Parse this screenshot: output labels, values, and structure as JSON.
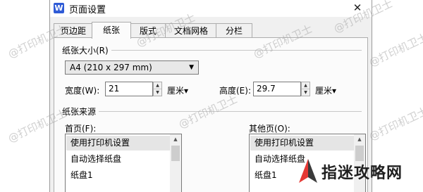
{
  "dialog": {
    "app_icon_letter": "W",
    "title": "页面设置",
    "close_glyph": "✕"
  },
  "tabs": [
    {
      "label": "页边距"
    },
    {
      "label": "纸张"
    },
    {
      "label": "版式"
    },
    {
      "label": "文档网格"
    },
    {
      "label": "分栏"
    }
  ],
  "paper_size": {
    "group_label": "纸张大小(R)",
    "selected": "A4 (210 x 297 mm)",
    "width_label": "宽度(W):",
    "width_value": "21",
    "width_unit": "厘米▾",
    "height_label": "高度(E):",
    "height_value": "29.7",
    "height_unit": "厘米▾"
  },
  "paper_source": {
    "group_label": "纸张来源",
    "first_page_label": "首页(F):",
    "first_page_items": [
      "使用打印机设置",
      "自动选择纸盘",
      "纸盘1"
    ],
    "other_pages_label": "其他页(O):",
    "other_pages_items": [
      "使用打印机设置",
      "自动选择纸盘",
      "纸盘1"
    ]
  },
  "watermark_text": "@打印机卫士",
  "site_logo_text": "指迷攻略网",
  "colors": {
    "accent": "#2f5bd6",
    "logo_red": "#e53935"
  }
}
